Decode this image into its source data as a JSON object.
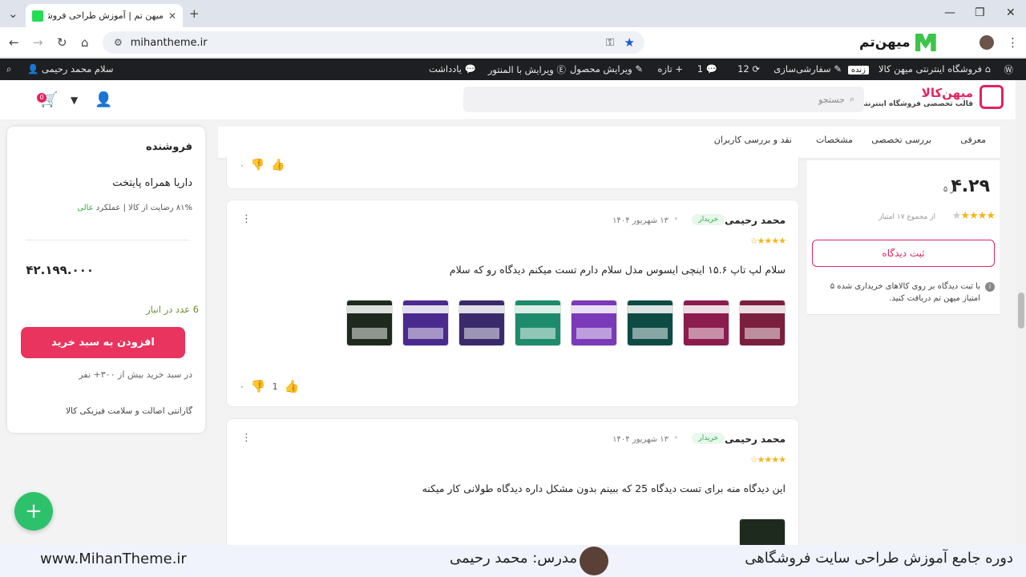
{
  "browser": {
    "tab_title": "میهن تم | آموزش طراحی فروشگاه",
    "url": "mihantheme.ir",
    "profile_brand": "میهن‌تم"
  },
  "adminbar": {
    "site_name": "فروشگاه اینترنتی میهن کالا",
    "live_badge": "زنده",
    "customize": "سفارشی‌سازی",
    "updates_count": "12",
    "comments_count": "1",
    "new": "تازه",
    "edit_product": "ویرایش محصول",
    "edit_elementor": "ویرایش با المنتور",
    "notes": "یادداشت",
    "greeting": "سلام محمد رحیمی"
  },
  "header": {
    "brand_name": "میهن‌کالا",
    "brand_tagline": "قالب تخصصی فروشگاه اینترنتی",
    "search_placeholder": "جستجو",
    "cart_count": "0"
  },
  "product_tabs": [
    "معرفی",
    "بررسی تخصصی",
    "مشخصات",
    "نقد و بررسی کاربران"
  ],
  "rating": {
    "score": "۴.۲۹",
    "score_of": "از ۵",
    "count_text": "از مجموع ۱۷ امتیاز",
    "submit_label": "ثبت دیدگاه",
    "note": "با ثبت دیدگاه بر روی کالاهای خریداری شده ۵ امتیاز میهن تم دریافت کنید."
  },
  "seller": {
    "title": "فروشنده",
    "name": "داریا همراه پایتخت",
    "satisfaction": "۸۱% رضایت از کالا | عملکرد",
    "performance": "عالی",
    "price": "۴۲.۱۹۹.۰۰۰",
    "stock": "6 عدد در انبار",
    "add_to_cart": "افزودن به سبد خرید",
    "buyers": "در سبد خرید بیش از ۳۰۰+ نفر",
    "warranty": "گارانتی اصالت و سلامت فیزیکی کالا"
  },
  "reviews": [
    {
      "author": "محمد رحیمی",
      "badge": "خریدار",
      "date": "۱۳ شهریور ۱۴۰۴",
      "text": "سلام لپ تاپ ۱۵.۶ اینچی ایسوس مدل سلام دارم تست میکنم دیدگاه رو که سلام",
      "likes": "1",
      "dislikes": "۰",
      "rating": 4,
      "thumb_colors": [
        "#7a1f3d",
        "#8c1c4e",
        "#0e4b44",
        "#7b3ab8",
        "#1e8c6c",
        "#3b2a6b",
        "#4a2a8e",
        "#1e2a1e"
      ]
    },
    {
      "author": "محمد رحیمی",
      "badge": "خریدار",
      "date": "۱۳ شهریور ۱۴۰۴",
      "text": "این دیدگاه منه برای تست دیدگاه 25 که ببینم بدون مشکل داره دیدگاه طولانی کار میکنه",
      "rating": 4
    }
  ],
  "prev_review": {
    "dislikes": "۰"
  },
  "banner": {
    "course": "دوره جامع آموزش طراحی سایت فروشگاهی",
    "teacher": "مدرس: محمد رحیمی",
    "url": "www.MihanTheme.ir"
  },
  "colors": {
    "accent": "#e0245e",
    "green": "#2eae49",
    "star": "#f3b51a"
  }
}
